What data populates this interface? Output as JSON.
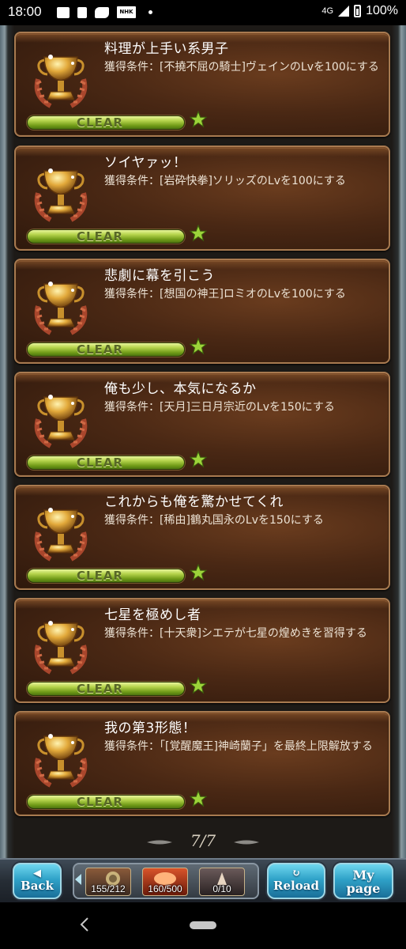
{
  "status_bar": {
    "time": "18:00",
    "network": "4G",
    "battery": "100%",
    "notification_icons": [
      "image-icon",
      "bag-icon",
      "horse-icon",
      "nhk-icon",
      "dot-icon"
    ],
    "nhk_text": "NHK"
  },
  "trophies": [
    {
      "title": "料理が上手い系男子",
      "condition": "獲得条件：[不撓不屈の騎士]ヴェインのLvを100にする",
      "clear": "CLEAR"
    },
    {
      "title": "ソイヤァッ！",
      "condition": "獲得条件：[岩砕快拳]ソリッズのLvを100にする",
      "clear": "CLEAR"
    },
    {
      "title": "悲劇に幕を引こう",
      "condition": "獲得条件：[想国の神王]ロミオのLvを100にする",
      "clear": "CLEAR"
    },
    {
      "title": "俺も少し、本気になるか",
      "condition": "獲得条件：[天月]三日月宗近のLvを150にする",
      "clear": "CLEAR"
    },
    {
      "title": "これからも俺を驚かせてくれ",
      "condition": "獲得条件：[稀由]鶴丸国永のLvを150にする",
      "clear": "CLEAR"
    },
    {
      "title": "七星を極めし者",
      "condition": "獲得条件：[十天衆]シエテが七星の煌めきを習得する",
      "clear": "CLEAR"
    },
    {
      "title": "我の第3形態！",
      "condition": "獲得条件：「[覚醒魔王]神崎蘭子」を最終上限解放する",
      "clear": "CLEAR"
    }
  ],
  "pager": {
    "current": "7/7"
  },
  "bottom_bar": {
    "back_label": "Back",
    "reload_label": "Reload",
    "mypage_label_1": "My",
    "mypage_label_2": "page",
    "resources": [
      {
        "name": "ap",
        "value": "155/212"
      },
      {
        "name": "bp",
        "value": "160/500"
      },
      {
        "name": "ep",
        "value": "0/10"
      }
    ]
  },
  "colors": {
    "panel_border": "#a87a50",
    "clear_green": "#b5d34b",
    "button_blue": "#2fa2c8",
    "star_green": "#9cd33a"
  }
}
